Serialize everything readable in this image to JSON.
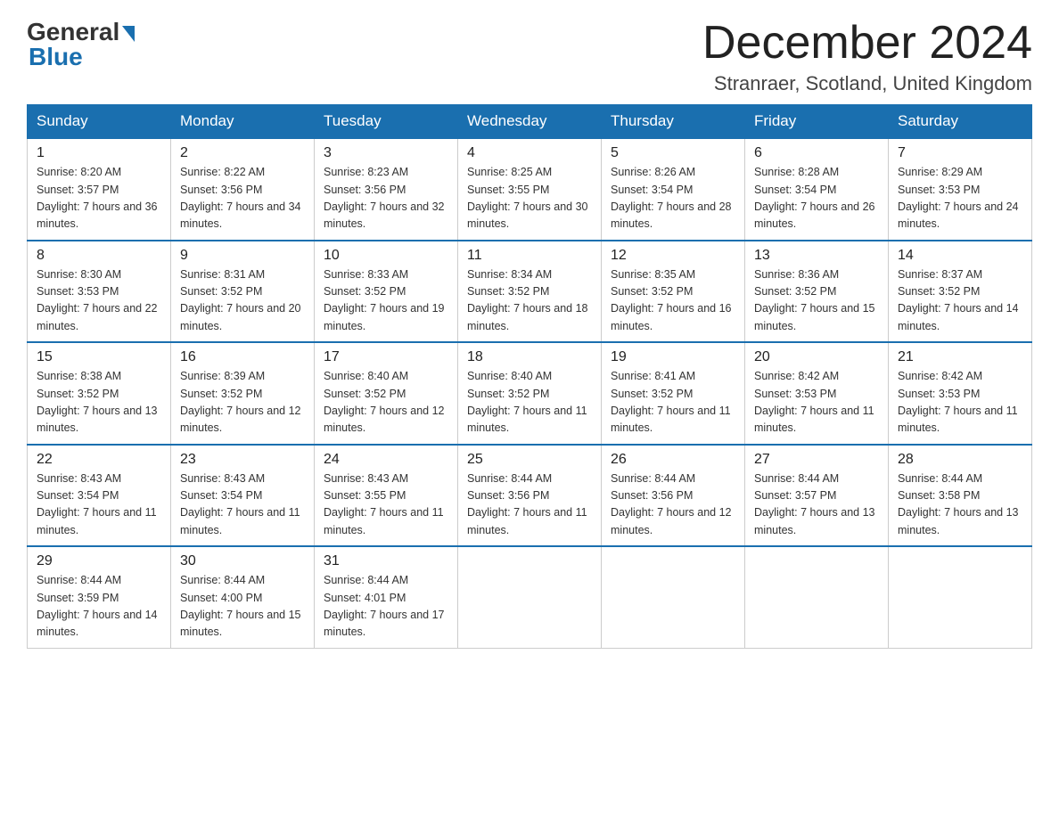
{
  "header": {
    "logo_general": "General",
    "logo_blue": "Blue",
    "month_title": "December 2024",
    "location": "Stranraer, Scotland, United Kingdom"
  },
  "calendar": {
    "days_of_week": [
      "Sunday",
      "Monday",
      "Tuesday",
      "Wednesday",
      "Thursday",
      "Friday",
      "Saturday"
    ],
    "weeks": [
      [
        {
          "day": "1",
          "sunrise": "8:20 AM",
          "sunset": "3:57 PM",
          "daylight": "7 hours and 36 minutes."
        },
        {
          "day": "2",
          "sunrise": "8:22 AM",
          "sunset": "3:56 PM",
          "daylight": "7 hours and 34 minutes."
        },
        {
          "day": "3",
          "sunrise": "8:23 AM",
          "sunset": "3:56 PM",
          "daylight": "7 hours and 32 minutes."
        },
        {
          "day": "4",
          "sunrise": "8:25 AM",
          "sunset": "3:55 PM",
          "daylight": "7 hours and 30 minutes."
        },
        {
          "day": "5",
          "sunrise": "8:26 AM",
          "sunset": "3:54 PM",
          "daylight": "7 hours and 28 minutes."
        },
        {
          "day": "6",
          "sunrise": "8:28 AM",
          "sunset": "3:54 PM",
          "daylight": "7 hours and 26 minutes."
        },
        {
          "day": "7",
          "sunrise": "8:29 AM",
          "sunset": "3:53 PM",
          "daylight": "7 hours and 24 minutes."
        }
      ],
      [
        {
          "day": "8",
          "sunrise": "8:30 AM",
          "sunset": "3:53 PM",
          "daylight": "7 hours and 22 minutes."
        },
        {
          "day": "9",
          "sunrise": "8:31 AM",
          "sunset": "3:52 PM",
          "daylight": "7 hours and 20 minutes."
        },
        {
          "day": "10",
          "sunrise": "8:33 AM",
          "sunset": "3:52 PM",
          "daylight": "7 hours and 19 minutes."
        },
        {
          "day": "11",
          "sunrise": "8:34 AM",
          "sunset": "3:52 PM",
          "daylight": "7 hours and 18 minutes."
        },
        {
          "day": "12",
          "sunrise": "8:35 AM",
          "sunset": "3:52 PM",
          "daylight": "7 hours and 16 minutes."
        },
        {
          "day": "13",
          "sunrise": "8:36 AM",
          "sunset": "3:52 PM",
          "daylight": "7 hours and 15 minutes."
        },
        {
          "day": "14",
          "sunrise": "8:37 AM",
          "sunset": "3:52 PM",
          "daylight": "7 hours and 14 minutes."
        }
      ],
      [
        {
          "day": "15",
          "sunrise": "8:38 AM",
          "sunset": "3:52 PM",
          "daylight": "7 hours and 13 minutes."
        },
        {
          "day": "16",
          "sunrise": "8:39 AM",
          "sunset": "3:52 PM",
          "daylight": "7 hours and 12 minutes."
        },
        {
          "day": "17",
          "sunrise": "8:40 AM",
          "sunset": "3:52 PM",
          "daylight": "7 hours and 12 minutes."
        },
        {
          "day": "18",
          "sunrise": "8:40 AM",
          "sunset": "3:52 PM",
          "daylight": "7 hours and 11 minutes."
        },
        {
          "day": "19",
          "sunrise": "8:41 AM",
          "sunset": "3:52 PM",
          "daylight": "7 hours and 11 minutes."
        },
        {
          "day": "20",
          "sunrise": "8:42 AM",
          "sunset": "3:53 PM",
          "daylight": "7 hours and 11 minutes."
        },
        {
          "day": "21",
          "sunrise": "8:42 AM",
          "sunset": "3:53 PM",
          "daylight": "7 hours and 11 minutes."
        }
      ],
      [
        {
          "day": "22",
          "sunrise": "8:43 AM",
          "sunset": "3:54 PM",
          "daylight": "7 hours and 11 minutes."
        },
        {
          "day": "23",
          "sunrise": "8:43 AM",
          "sunset": "3:54 PM",
          "daylight": "7 hours and 11 minutes."
        },
        {
          "day": "24",
          "sunrise": "8:43 AM",
          "sunset": "3:55 PM",
          "daylight": "7 hours and 11 minutes."
        },
        {
          "day": "25",
          "sunrise": "8:44 AM",
          "sunset": "3:56 PM",
          "daylight": "7 hours and 11 minutes."
        },
        {
          "day": "26",
          "sunrise": "8:44 AM",
          "sunset": "3:56 PM",
          "daylight": "7 hours and 12 minutes."
        },
        {
          "day": "27",
          "sunrise": "8:44 AM",
          "sunset": "3:57 PM",
          "daylight": "7 hours and 13 minutes."
        },
        {
          "day": "28",
          "sunrise": "8:44 AM",
          "sunset": "3:58 PM",
          "daylight": "7 hours and 13 minutes."
        }
      ],
      [
        {
          "day": "29",
          "sunrise": "8:44 AM",
          "sunset": "3:59 PM",
          "daylight": "7 hours and 14 minutes."
        },
        {
          "day": "30",
          "sunrise": "8:44 AM",
          "sunset": "4:00 PM",
          "daylight": "7 hours and 15 minutes."
        },
        {
          "day": "31",
          "sunrise": "8:44 AM",
          "sunset": "4:01 PM",
          "daylight": "7 hours and 17 minutes."
        },
        null,
        null,
        null,
        null
      ]
    ]
  }
}
